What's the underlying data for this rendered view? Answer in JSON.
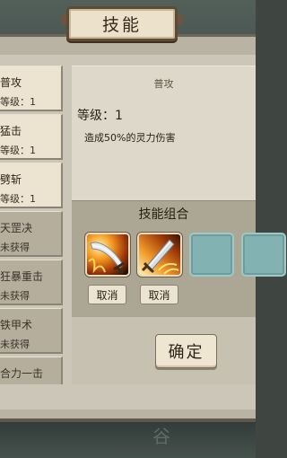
{
  "window": {
    "title": "技能"
  },
  "background": {
    "glyph": "谷"
  },
  "skill_list": [
    {
      "name": "普攻",
      "level": "等级：1",
      "state": "learned"
    },
    {
      "name": "猛击",
      "level": "等级：1",
      "state": "learned"
    },
    {
      "name": "劈斩",
      "level": "等级：1",
      "state": "learned"
    },
    {
      "name": "天罡决",
      "level": "未获得",
      "state": "locked"
    },
    {
      "name": "狂暴重击",
      "level": "未获得",
      "state": "locked"
    },
    {
      "name": "铁甲术",
      "level": "未获得",
      "state": "locked"
    },
    {
      "name": "合力一击",
      "level": "",
      "state": "locked"
    }
  ],
  "detail": {
    "name": "普攻",
    "level": "等级：1",
    "description": "造成50%的灵力伤害"
  },
  "combo": {
    "title": "技能组合",
    "slots": [
      {
        "state": "filled",
        "icon": "flaming-sword-icon",
        "cancel_label": "取消"
      },
      {
        "state": "filled",
        "icon": "fire-blade-icon",
        "cancel_label": "取消"
      },
      {
        "state": "empty"
      },
      {
        "state": "empty"
      }
    ]
  },
  "confirm_label": "确定",
  "colors": {
    "panel": "#cbc6b7",
    "learned_item": "#ece4d0",
    "locked_item": "#b5ae9d",
    "empty_slot": "#83b2b3",
    "title_plate": "#ece2cc"
  }
}
